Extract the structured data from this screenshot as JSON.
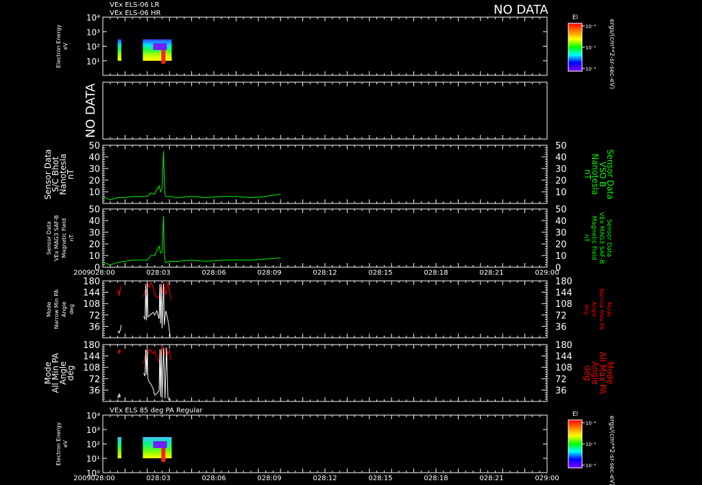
{
  "header": {
    "line1": "VEx ELS-06 LR",
    "line2": "VEx ELS-06 HR",
    "nodata": "NO DATA"
  },
  "time_axis": {
    "year": "2009",
    "ticks": [
      "028:00",
      "028:03",
      "028:06",
      "028:09",
      "028:12",
      "028:15",
      "028:18",
      "028:21",
      "029:00"
    ]
  },
  "colorbar": {
    "title": "El",
    "unit": "ergs/(cm**2-sr-sec-eV)",
    "ticks": [
      "10⁻⁴",
      "10⁻⁵",
      "10⁻⁶"
    ]
  },
  "bottom_title": "VEx ELS 85 deg PA Regular",
  "chart_data": [
    {
      "type": "heatmap",
      "panel": "ELS-06 energy spectrogram",
      "ylabel": [
        "Electron Energy",
        "eV"
      ],
      "yticks": [
        "10⁴",
        "10³",
        "10²",
        "10¹"
      ],
      "yscale": "log",
      "ylim": [
        1,
        10000
      ],
      "xlim": [
        "028:00",
        "029:00"
      ],
      "data_intervals": [
        [
          "028:02.0",
          "028:02.5"
        ],
        [
          "028:05.4",
          "028:09.3"
        ]
      ],
      "energy_range_eV": [
        10,
        300
      ]
    },
    {
      "type": "heatmap",
      "panel": "empty",
      "nodata_label": "NO DATA"
    },
    {
      "type": "line",
      "ylabel_left": [
        "Sensor Data",
        "S/C Bhot",
        "Nanotesla",
        "nT"
      ],
      "ylabel_right": [
        "Sensor Data",
        "VSO B",
        "Nanotesla",
        "nT"
      ],
      "yticks": [
        "50",
        "40",
        "30",
        "20",
        "10"
      ],
      "ylim": [
        0,
        50
      ],
      "x_minutes": [
        0,
        1,
        2,
        3,
        4,
        5,
        6,
        6.5,
        7,
        7.3,
        7.6,
        7.8,
        8.0,
        8.2,
        8.3,
        8.4,
        8.5,
        8.7,
        9.0,
        10,
        12,
        14,
        16,
        18,
        20,
        22,
        24
      ],
      "series": [
        {
          "color": "#00ff00",
          "values": [
            6,
            3,
            5,
            5,
            6,
            6,
            6,
            9,
            8,
            12,
            15,
            10,
            13,
            45,
            20,
            8,
            6,
            6,
            6,
            5,
            6,
            5,
            6,
            6,
            5,
            6,
            8
          ]
        }
      ]
    },
    {
      "type": "line",
      "ylabel_left": [
        "Sensor Data",
        "VEx MAG3 SAF-B",
        "Magnetic Field",
        "nT"
      ],
      "ylabel_right": [
        "Sensor Data",
        "VEx MAG3 SAF-B",
        "Magnetic Field",
        "nT"
      ],
      "yticks": [
        "50",
        "40",
        "30",
        "20",
        "10",
        "0"
      ],
      "ylim": [
        0,
        50
      ],
      "x_minutes": [
        0,
        1,
        2,
        3,
        4,
        5,
        6,
        6.5,
        7,
        7.3,
        7.6,
        7.8,
        8.0,
        8.2,
        8.3,
        8.4,
        8.5,
        8.7,
        9.0,
        10,
        12,
        14,
        16,
        18,
        20,
        22,
        24
      ],
      "series": [
        {
          "color": "#00ff00",
          "values": [
            4,
            2,
            4,
            5,
            6,
            6,
            6,
            10,
            10,
            14,
            18,
            12,
            13,
            44,
            12,
            6,
            4,
            4,
            5,
            5,
            6,
            5,
            6,
            6,
            6,
            7,
            8
          ]
        }
      ]
    },
    {
      "type": "line",
      "ylabel_left": [
        "Mode",
        "Narrow Min PA",
        "Angle",
        "deg"
      ],
      "ylabel_right": [
        "Mode",
        "Narrow Max PA",
        "Angle",
        "deg"
      ],
      "yticks": [
        "180",
        "144",
        "108",
        "72",
        "36"
      ],
      "ylim": [
        0,
        180
      ],
      "series": [
        {
          "name": "Narrow Max PA",
          "color": "#ff0000",
          "x_minutes": [
            2.0,
            2.1,
            2.2,
            2.3,
            2.4,
            2.45
          ],
          "values": [
            140,
            150,
            132,
            145,
            160,
            165
          ]
        },
        {
          "name": "Narrow Max PA",
          "color": "#ff0000",
          "x_minutes": [
            5.5,
            5.7,
            5.9,
            6.1,
            6.3,
            6.5,
            6.8,
            7.0,
            7.3,
            7.6,
            7.8,
            8.0,
            8.2,
            8.5,
            8.8,
            9.0,
            9.2
          ],
          "values": [
            130,
            150,
            145,
            170,
            160,
            175,
            160,
            140,
            125,
            130,
            160,
            140,
            175,
            135,
            175,
            150,
            120
          ]
        },
        {
          "name": "Narrow Min PA",
          "color": "#ffffff",
          "x_minutes": [
            2.0,
            2.1,
            2.2,
            2.3,
            2.4,
            2.45
          ],
          "values": [
            18,
            20,
            15,
            22,
            25,
            40
          ]
        },
        {
          "name": "Narrow Min PA",
          "color": "#ffffff",
          "x_minutes": [
            5.5,
            5.7,
            5.8,
            5.9,
            6.0,
            6.1,
            6.3,
            6.5,
            6.8,
            7.0,
            7.3,
            7.6,
            7.7,
            7.8,
            7.9,
            8.0,
            8.2,
            8.3,
            8.5,
            8.8,
            9.0,
            9.1,
            9.2
          ],
          "values": [
            68,
            58,
            170,
            55,
            170,
            66,
            70,
            75,
            80,
            72,
            85,
            60,
            170,
            45,
            170,
            30,
            170,
            40,
            85,
            55,
            20,
            5,
            5
          ]
        }
      ]
    },
    {
      "type": "line",
      "ylabel_left": [
        "Mode",
        "All Min PA",
        "Angle",
        "deg"
      ],
      "ylabel_right": [
        "Mode",
        "All Max PA",
        "Angle",
        "deg"
      ],
      "yticks": [
        "180",
        "144",
        "108",
        "72",
        "36"
      ],
      "ylim": [
        0,
        180
      ],
      "series": [
        {
          "name": "All Max PA",
          "color": "#ff0000",
          "x_minutes": [
            2.0,
            2.1,
            2.2,
            2.3,
            2.4
          ],
          "values": [
            160,
            150,
            165,
            155,
            160
          ]
        },
        {
          "name": "All Max PA",
          "color": "#ff0000",
          "x_minutes": [
            5.5,
            5.7,
            5.9,
            6.1,
            6.3,
            6.5,
            6.8,
            7.0,
            7.3,
            7.6,
            7.8,
            8.0,
            8.2,
            8.5,
            8.8,
            9.0,
            9.2
          ],
          "values": [
            120,
            145,
            160,
            150,
            165,
            160,
            150,
            160,
            140,
            125,
            150,
            175,
            140,
            170,
            150,
            160,
            130
          ]
        },
        {
          "name": "All Min PA",
          "color": "#ffffff",
          "x_minutes": [
            2.0,
            2.1,
            2.2,
            2.3,
            2.4
          ],
          "values": [
            18,
            12,
            25,
            15,
            20
          ]
        },
        {
          "name": "All Min PA",
          "color": "#ffffff",
          "x_minutes": [
            5.5,
            5.7,
            5.8,
            5.9,
            6.0,
            6.1,
            6.3,
            6.5,
            6.8,
            7.0,
            7.3,
            7.6,
            7.7,
            7.8,
            7.9,
            8.0,
            8.2,
            8.4,
            8.6,
            8.8,
            9.0,
            9.2
          ],
          "values": [
            90,
            80,
            165,
            85,
            165,
            70,
            60,
            55,
            40,
            20,
            25,
            35,
            165,
            15,
            165,
            10,
            170,
            10,
            170,
            10,
            5,
            5
          ]
        }
      ]
    },
    {
      "type": "heatmap",
      "panel": "ELS 85 deg PA energy spectrogram",
      "ylabel": [
        "Electron Energy",
        "eV"
      ],
      "yticks": [
        "10⁴",
        "10³",
        "10²",
        "10¹",
        "10⁰"
      ],
      "yscale": "log",
      "ylim": [
        1,
        10000
      ],
      "xlim": [
        "028:00",
        "029:00"
      ],
      "data_intervals": [
        [
          "028:02.0",
          "028:02.5"
        ],
        [
          "028:05.4",
          "028:09.3"
        ]
      ],
      "energy_range_eV": [
        10,
        300
      ]
    }
  ]
}
